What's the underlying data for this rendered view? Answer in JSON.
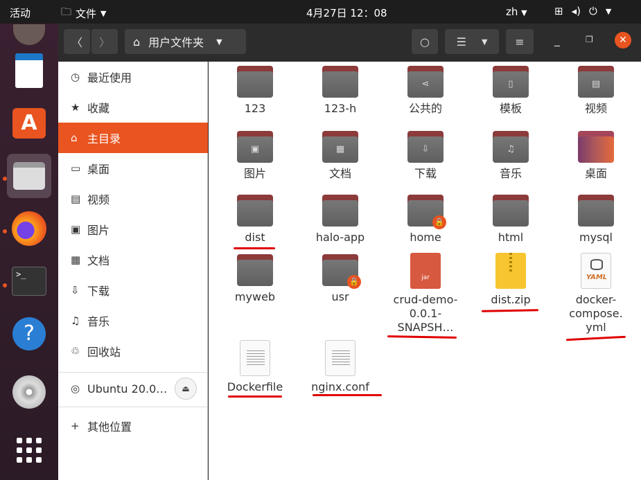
{
  "topbar": {
    "activities": "活动",
    "app_menu": "文件",
    "clock": "4月27日 12：08",
    "language": "zh"
  },
  "header": {
    "location": "用户文件夹"
  },
  "sidebar": {
    "items": [
      {
        "label": "最近使用",
        "icon": "clock-icon"
      },
      {
        "label": "收藏",
        "icon": "star-icon"
      },
      {
        "label": "主目录",
        "icon": "home-icon"
      },
      {
        "label": "桌面",
        "icon": "desktop-icon"
      },
      {
        "label": "视频",
        "icon": "video-icon"
      },
      {
        "label": "图片",
        "icon": "picture-icon"
      },
      {
        "label": "文档",
        "icon": "document-icon"
      },
      {
        "label": "下载",
        "icon": "download-icon"
      },
      {
        "label": "音乐",
        "icon": "music-icon"
      },
      {
        "label": "回收站",
        "icon": "trash-icon"
      }
    ],
    "device": "Ubuntu 20.0…",
    "other_locations": "其他位置"
  },
  "files": [
    {
      "name": "123",
      "kind": "folder"
    },
    {
      "name": "123-h",
      "kind": "folder"
    },
    {
      "name": "公共的",
      "kind": "folder-share"
    },
    {
      "name": "模板",
      "kind": "folder-template"
    },
    {
      "name": "视频",
      "kind": "folder-video"
    },
    {
      "name": "图片",
      "kind": "folder-picture"
    },
    {
      "name": "文档",
      "kind": "folder-document"
    },
    {
      "name": "下载",
      "kind": "folder-download"
    },
    {
      "name": "音乐",
      "kind": "folder-music"
    },
    {
      "name": "桌面",
      "kind": "folder-desktop"
    },
    {
      "name": "dist",
      "kind": "folder"
    },
    {
      "name": "halo-app",
      "kind": "folder"
    },
    {
      "name": "home",
      "kind": "folder-locked"
    },
    {
      "name": "html",
      "kind": "folder"
    },
    {
      "name": "mysql",
      "kind": "folder"
    },
    {
      "name": "myweb",
      "kind": "folder"
    },
    {
      "name": "usr",
      "kind": "folder-locked"
    },
    {
      "name_lines": [
        "crud-demo-",
        "0.0.1-",
        "SNAPSH…"
      ],
      "kind": "jar",
      "badge": "jar"
    },
    {
      "name": "dist.zip",
      "kind": "zip"
    },
    {
      "name_lines": [
        "docker-",
        "compose.",
        "yml"
      ],
      "kind": "yml",
      "badge": "YAML"
    },
    {
      "name": "Dockerfile",
      "kind": "text"
    },
    {
      "name": "nginx.conf",
      "kind": "text"
    }
  ],
  "colors": {
    "accent": "#e95420",
    "annotation": "#e00000",
    "topbar": "#1d1d1d",
    "folder": "#6e6e6e",
    "folder_tab": "#8c3a3a"
  }
}
